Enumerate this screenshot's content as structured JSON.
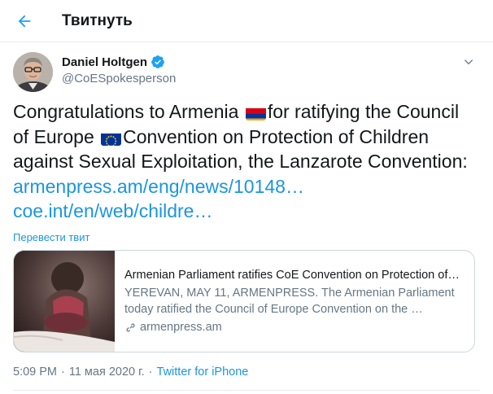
{
  "header": {
    "title": "Твитнуть",
    "back_icon": "arrow-left-icon"
  },
  "author": {
    "name": "Daniel Holtgen",
    "handle": "@CoESpokesperson",
    "verified": true
  },
  "tweet": {
    "line1_a": "Congratulations to Armenia ",
    "line1_b": "for ratifying the Council",
    "line2_a": "of Europe ",
    "line2_b": "Convention on Protection of Children",
    "line3": "against Sexual Exploitation, the Lanzarote Convention:",
    "link1": "armenpress.am/eng/news/10148…",
    "link2": "coe.int/en/web/childre…",
    "flag_icons": [
      "armenia-flag-icon",
      "eu-flag-icon"
    ]
  },
  "translate_label": "Перевести твит",
  "card": {
    "title": "Armenian Parliament ratifies CoE Convention on Protection of…",
    "desc_line1": "YEREVAN, MAY 11, ARMENPRESS. The Armenian Parliament",
    "desc_line2": "today ratified the Council of Europe Convention on the …",
    "domain": "armenpress.am"
  },
  "meta": {
    "time": "5:09 PM",
    "separator": "·",
    "date": "11 мая 2020 г.",
    "source": "Twitter for iPhone"
  },
  "colors": {
    "accent": "#1b95e0",
    "secondary_text": "#657786",
    "border": "#e6ecf0"
  }
}
